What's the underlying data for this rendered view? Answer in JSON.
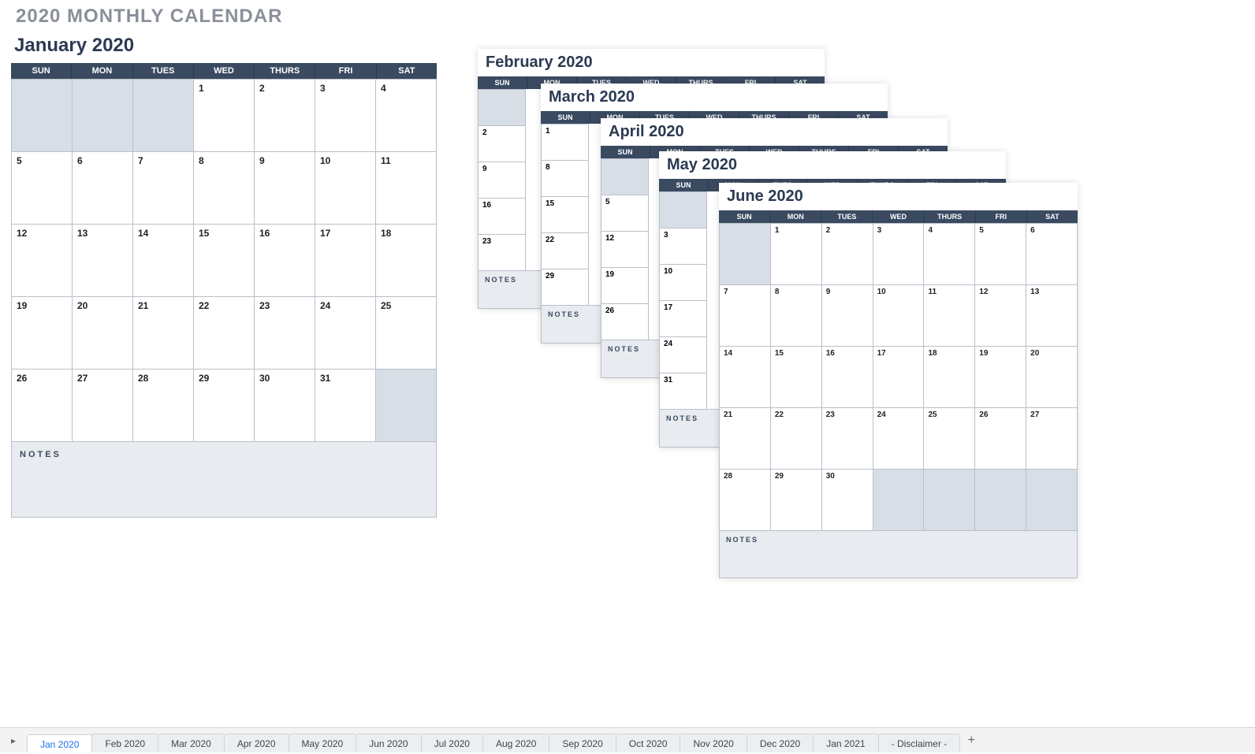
{
  "title": "2020 MONTHLY CALENDAR",
  "days": [
    "SUN",
    "MON",
    "TUES",
    "WED",
    "THURS",
    "FRI",
    "SAT"
  ],
  "notes_label": "NOTES",
  "jan": {
    "title": "January 2020",
    "weeks": [
      [
        {
          "d": "",
          "dim": true
        },
        {
          "d": "",
          "dim": true
        },
        {
          "d": "",
          "dim": true
        },
        {
          "d": "1"
        },
        {
          "d": "2"
        },
        {
          "d": "3"
        },
        {
          "d": "4"
        }
      ],
      [
        {
          "d": "5"
        },
        {
          "d": "6"
        },
        {
          "d": "7"
        },
        {
          "d": "8"
        },
        {
          "d": "9"
        },
        {
          "d": "10"
        },
        {
          "d": "11"
        }
      ],
      [
        {
          "d": "12"
        },
        {
          "d": "13"
        },
        {
          "d": "14"
        },
        {
          "d": "15"
        },
        {
          "d": "16"
        },
        {
          "d": "17"
        },
        {
          "d": "18"
        }
      ],
      [
        {
          "d": "19"
        },
        {
          "d": "20"
        },
        {
          "d": "21"
        },
        {
          "d": "22"
        },
        {
          "d": "23"
        },
        {
          "d": "24"
        },
        {
          "d": "25"
        }
      ],
      [
        {
          "d": "26"
        },
        {
          "d": "27"
        },
        {
          "d": "28"
        },
        {
          "d": "29"
        },
        {
          "d": "30"
        },
        {
          "d": "31"
        },
        {
          "d": "",
          "dim": true
        }
      ]
    ]
  },
  "feb": {
    "title": "February 2020",
    "col": [
      {
        "d": "",
        "dim": true
      },
      {
        "d": "2"
      },
      {
        "d": "9"
      },
      {
        "d": "16"
      },
      {
        "d": "23"
      }
    ]
  },
  "mar": {
    "title": "March 2020",
    "col": [
      {
        "d": "1"
      },
      {
        "d": "8"
      },
      {
        "d": "15"
      },
      {
        "d": "22"
      },
      {
        "d": "29"
      }
    ]
  },
  "apr": {
    "title": "April 2020",
    "col": [
      {
        "d": "",
        "dim": true
      },
      {
        "d": "5"
      },
      {
        "d": "12"
      },
      {
        "d": "19"
      },
      {
        "d": "26"
      }
    ]
  },
  "may": {
    "title": "May 2020",
    "col": [
      {
        "d": "",
        "dim": true
      },
      {
        "d": "3"
      },
      {
        "d": "10"
      },
      {
        "d": "17"
      },
      {
        "d": "24"
      },
      {
        "d": "31"
      }
    ]
  },
  "jun": {
    "title": "June 2020",
    "weeks": [
      [
        {
          "d": "",
          "dim": true
        },
        {
          "d": "1"
        },
        {
          "d": "2"
        },
        {
          "d": "3"
        },
        {
          "d": "4"
        },
        {
          "d": "5"
        },
        {
          "d": "6"
        }
      ],
      [
        {
          "d": "7"
        },
        {
          "d": "8"
        },
        {
          "d": "9"
        },
        {
          "d": "10"
        },
        {
          "d": "11"
        },
        {
          "d": "12"
        },
        {
          "d": "13"
        }
      ],
      [
        {
          "d": "14"
        },
        {
          "d": "15"
        },
        {
          "d": "16"
        },
        {
          "d": "17"
        },
        {
          "d": "18"
        },
        {
          "d": "19"
        },
        {
          "d": "20"
        }
      ],
      [
        {
          "d": "21"
        },
        {
          "d": "22"
        },
        {
          "d": "23"
        },
        {
          "d": "24"
        },
        {
          "d": "25"
        },
        {
          "d": "26"
        },
        {
          "d": "27"
        }
      ],
      [
        {
          "d": "28"
        },
        {
          "d": "29"
        },
        {
          "d": "30"
        },
        {
          "d": "",
          "dim": true
        },
        {
          "d": "",
          "dim": true
        },
        {
          "d": "",
          "dim": true
        },
        {
          "d": "",
          "dim": true
        }
      ]
    ]
  },
  "tabs": [
    "Jan 2020",
    "Feb 2020",
    "Mar 2020",
    "Apr 2020",
    "May 2020",
    "Jun 2020",
    "Jul 2020",
    "Aug 2020",
    "Sep 2020",
    "Oct 2020",
    "Nov 2020",
    "Dec 2020",
    "Jan 2021",
    "- Disclaimer -"
  ],
  "active_tab": 0,
  "plus": "+"
}
